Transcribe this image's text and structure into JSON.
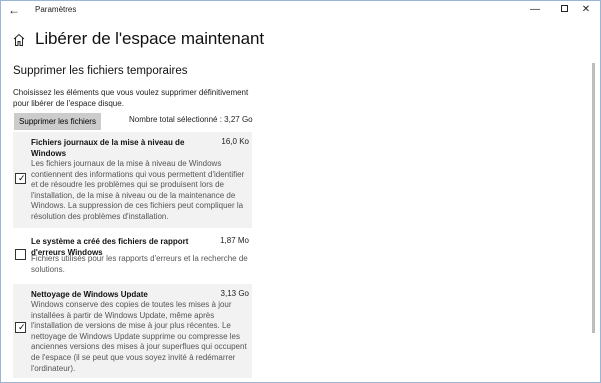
{
  "window": {
    "title": "Paramètres",
    "back_glyph": "←",
    "min_glyph": "—",
    "close_glyph": "✕"
  },
  "header": {
    "title": "Libérer de l'espace maintenant"
  },
  "section": {
    "title": "Supprimer les fichiers temporaires",
    "intro": "Choisissez les éléments que vous voulez supprimer définitivement pour libérer de l'espace disque.",
    "remove_button": "Supprimer les fichiers",
    "total_selected": "Nombre total sélectionné : 3,27 Go"
  },
  "items": [
    {
      "name": "Fichiers journaux de la mise à niveau de Windows",
      "size": "16,0 Ko",
      "checked": true,
      "description": "Les fichiers journaux de la mise à niveau de Windows contiennent des informations qui vous permettent d'identifier et de résoudre les problèmes qui se produisent lors de l'installation, de la mise à niveau ou de la maintenance de Windows. La suppression de ces fichiers peut compliquer la résolution des problèmes d'installation."
    },
    {
      "name": "Le système a créé des fichiers de rapport d'erreurs Windows",
      "size": "1,87 Mo",
      "checked": false,
      "description": "Fichiers utilisés pour les rapports d'erreurs et la recherche de solutions."
    },
    {
      "name": "Nettoyage de Windows Update",
      "size": "3,13 Go",
      "checked": true,
      "description": "Windows conserve des copies de toutes les mises à jour installées à partir de Windows Update, même après l'installation de versions de mise à jour plus récentes. Le nettoyage de Windows Update supprime ou compresse les anciennes versions des mises à jour superflues qui occupent de l'espace (il se peut que vous soyez invité à redémarrer l'ordinateur)."
    }
  ],
  "colors": {
    "item_shade": "#f2f2f2",
    "button_bg": "#cccccc",
    "window_border": "#9ab6d6"
  }
}
